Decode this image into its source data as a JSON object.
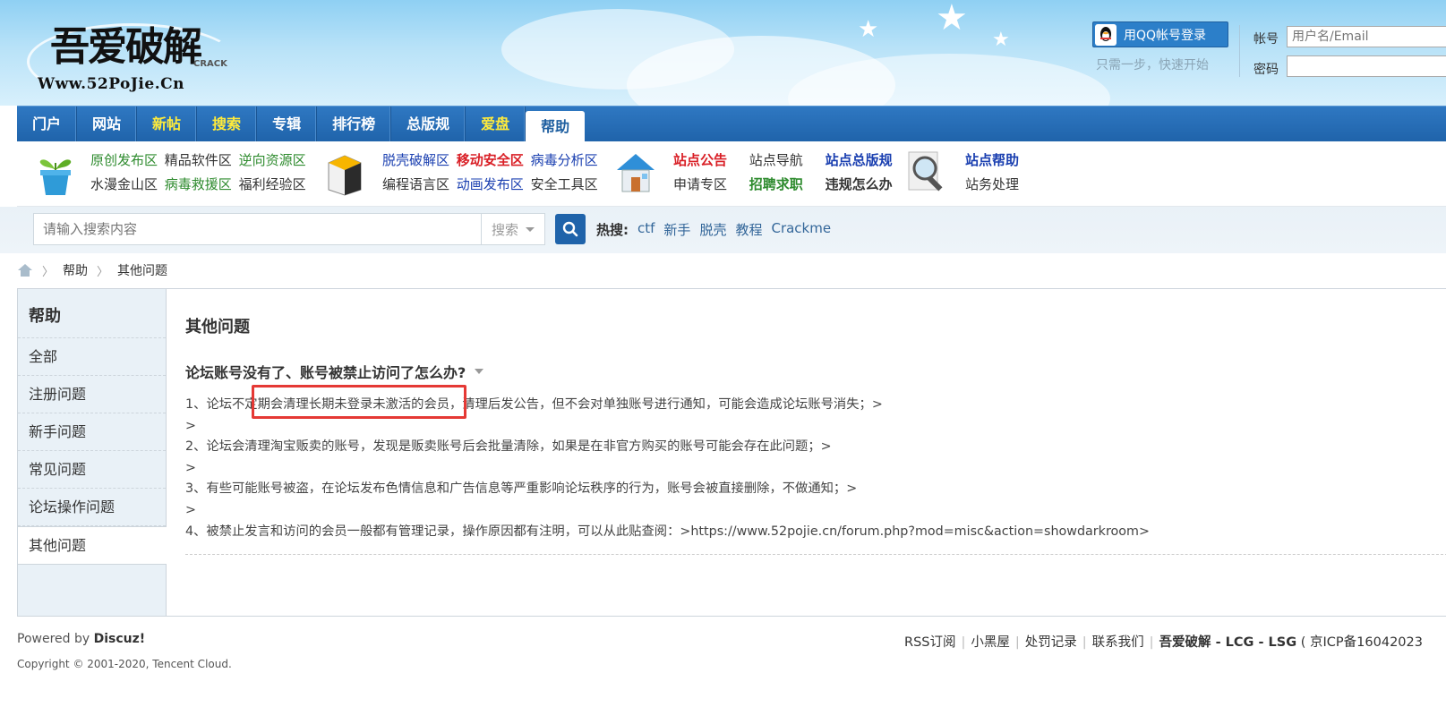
{
  "header": {
    "logo_text": "吾爱破解",
    "logo_sub": "CRACK",
    "logo_url": "Www.52PoJie.Cn",
    "qq_login": "用QQ帐号登录",
    "qq_hint": "只需一步，快速开始",
    "account_label": "帐号",
    "account_placeholder": "用户名/Email",
    "password_label": "密码"
  },
  "nav": [
    {
      "label": "门户"
    },
    {
      "label": "网站"
    },
    {
      "label": "新帖"
    },
    {
      "label": "搜索"
    },
    {
      "label": "专辑"
    },
    {
      "label": "排行榜"
    },
    {
      "label": "总版规"
    },
    {
      "label": "爱盘"
    },
    {
      "label": "帮助"
    }
  ],
  "quick": {
    "col1_row1": [
      "原创发布区",
      "精品软件区",
      "逆向资源区"
    ],
    "col1_row2": [
      "水漫金山区",
      "病毒救援区",
      "福利经验区"
    ],
    "col2_row1": [
      "脱壳破解区",
      "移动安全区",
      "病毒分析区"
    ],
    "col2_row2": [
      "编程语言区",
      "动画发布区",
      "安全工具区"
    ],
    "col3_row1": [
      "站点公告",
      "站点导航",
      "站点总版规"
    ],
    "col3_row2": [
      "申请专区",
      "招聘求职",
      "违规怎么办"
    ],
    "col4_row1": [
      "站点帮助"
    ],
    "col4_row2": [
      "站务处理"
    ]
  },
  "search": {
    "placeholder": "请输入搜索内容",
    "type": "搜索",
    "hot_label": "热搜:",
    "hot_terms": [
      "ctf",
      "新手",
      "脱壳",
      "教程",
      "Crackme"
    ]
  },
  "breadcrumb": [
    "帮助",
    "其他问题"
  ],
  "sidebar": {
    "title": "帮助",
    "items": [
      {
        "label": "全部"
      },
      {
        "label": "注册问题"
      },
      {
        "label": "新手问题"
      },
      {
        "label": "常见问题"
      },
      {
        "label": "论坛操作问题"
      },
      {
        "label": "其他问题"
      }
    ]
  },
  "content": {
    "title": "其他问题",
    "question": "论坛账号没有了、账号被禁止访问了怎么办?",
    "lines": [
      "1、论坛不定期会清理长期未登录未激活的会员，清理后发公告，但不会对单独账号进行通知，可能会造成论坛账号消失；>",
      ">",
      "2、论坛会清理淘宝贩卖的账号，发现是贩卖账号后会批量清除，如果是在非官方购买的账号可能会存在此问题；>",
      ">",
      "3、有些可能账号被盗，在论坛发布色情信息和广告信息等严重影响论坛秩序的行为，账号会被直接删除，不做通知；>",
      ">",
      "4、被禁止发言和访问的会员一般都有管理记录，操作原因都有注明，可以从此贴查阅：>https://www.52pojie.cn/forum.php?mod=misc&action=showdarkroom>"
    ]
  },
  "footer": {
    "powered_prefix": "Powered by",
    "powered_brand": "Discuz!",
    "copyright": "Copyright © 2001-2020, Tencent Cloud.",
    "links": [
      "RSS订阅",
      "小黑屋",
      "处罚记录",
      "联系我们"
    ],
    "site_name": "吾爱破解 - LCG - LSG",
    "icp": "( 京ICP备16042023"
  },
  "colors": {
    "nav_blue": "#1f63aa",
    "highlight_red": "#e53935",
    "green_link": "#2e8b2e",
    "red_link": "#d91f26",
    "blue_link": "#1a3fb0"
  }
}
